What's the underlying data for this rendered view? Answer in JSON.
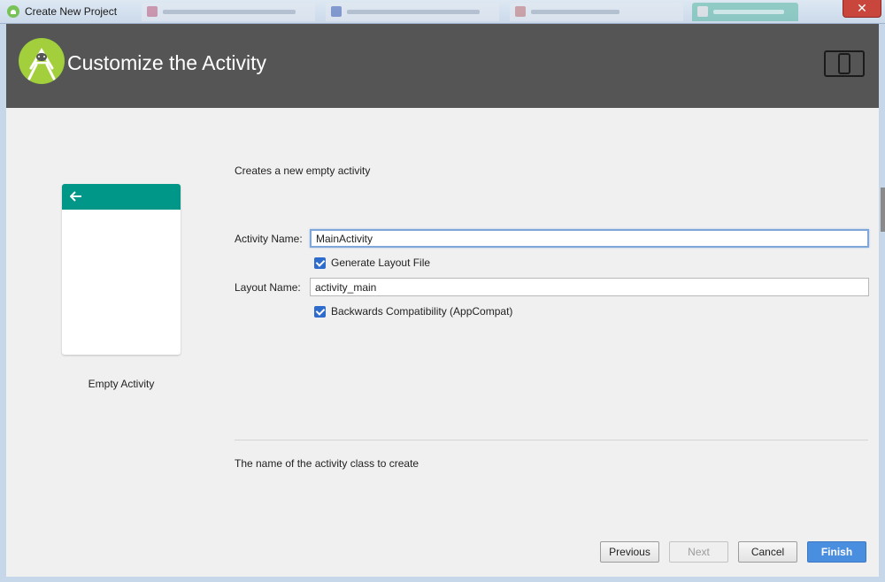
{
  "window": {
    "title": "Create New Project",
    "close_label": "✕"
  },
  "header": {
    "title": "Customize the Activity"
  },
  "preview": {
    "label": "Empty Activity"
  },
  "form": {
    "description": "Creates a new empty activity",
    "activity_name_label": "Activity Name:",
    "activity_name_value": "MainActivity",
    "generate_layout_label": "Generate Layout File",
    "layout_name_label": "Layout Name:",
    "layout_name_value": "activity_main",
    "backwards_compat_label": "Backwards Compatibility (AppCompat)",
    "hint": "The name of the activity class to create"
  },
  "buttons": {
    "previous": "Previous",
    "next": "Next",
    "cancel": "Cancel",
    "finish": "Finish"
  },
  "colors": {
    "header_bg": "#555555",
    "android_green": "#9ccf3c",
    "preview_bar": "#009688",
    "primary_button": "#4a8ee0"
  }
}
